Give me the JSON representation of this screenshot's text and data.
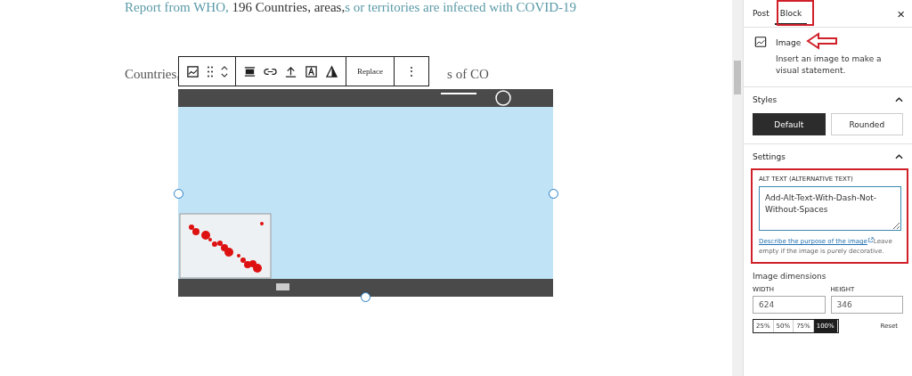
{
  "editor": {
    "top_line": [
      {
        "text": "Report from WHO, ",
        "kind": "link"
      },
      {
        "text": "196 Countries, areas,",
        "kind": "plain"
      },
      {
        "text": "s or territories are infected with COVID-19",
        "kind": "link"
      }
    ],
    "paragraph": {
      "before": "Countries,",
      "after": "s of CO"
    },
    "toolbar": {
      "replace_label": "Replace",
      "more_label": "⋮"
    }
  },
  "sidebar": {
    "tabs": [
      {
        "label": "Post",
        "selected": false
      },
      {
        "label": "Block",
        "selected": true
      }
    ],
    "close_label": "×",
    "block": {
      "title": "Image",
      "description": "Insert an image to make a visual statement."
    },
    "styles": {
      "title": "Styles",
      "expanded": true,
      "options": [
        {
          "label": "Default",
          "selected": true
        },
        {
          "label": "Rounded",
          "selected": false
        }
      ]
    },
    "settings": {
      "title": "Settings",
      "expanded": true,
      "alt_label": "ALT TEXT (ALTERNATIVE TEXT)",
      "alt_value": "Add-Alt-Text-With-Dash-Not-Without-Spaces",
      "help_link": "Describe the purpose of the image",
      "help_text": "Leave empty if the image is purely decorative.",
      "dimensions_title": "Image dimensions",
      "width_label": "WIDTH",
      "width_value": "624",
      "height_label": "HEIGHT",
      "height_value": "346",
      "scales": [
        {
          "label": "25%",
          "selected": false
        },
        {
          "label": "50%",
          "selected": false
        },
        {
          "label": "75%",
          "selected": false
        },
        {
          "label": "100%",
          "selected": true
        }
      ],
      "reset_label": "Reset"
    }
  }
}
